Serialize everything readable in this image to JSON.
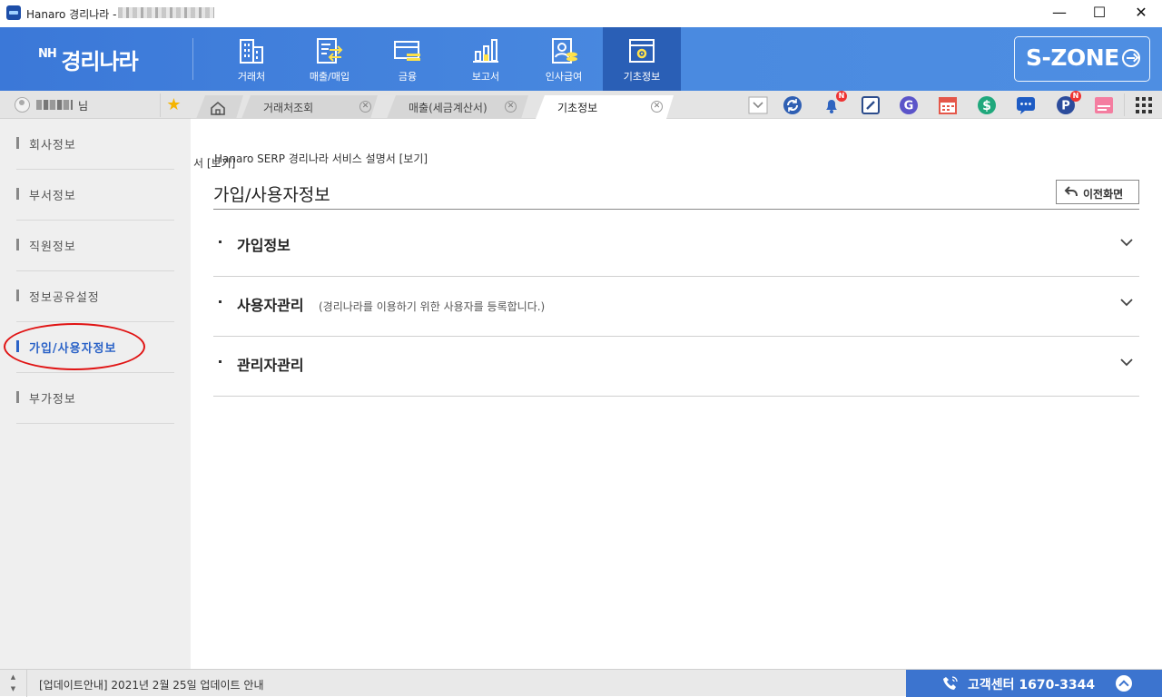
{
  "window": {
    "title": "Hanaro 경리나라 -",
    "controls": {
      "minimize": "—",
      "maximize": "☐",
      "close": "✕"
    }
  },
  "brand": {
    "prefix": "NH",
    "name": "경리나라"
  },
  "nav": {
    "items": [
      {
        "label": "거래처",
        "icon": "building-icon"
      },
      {
        "label": "매출/매입",
        "icon": "exchange-doc-icon"
      },
      {
        "label": "금융",
        "icon": "card-icon"
      },
      {
        "label": "보고서",
        "icon": "bar-chart-icon"
      },
      {
        "label": "인사급여",
        "icon": "person-coin-icon"
      },
      {
        "label": "기초정보",
        "icon": "settings-window-icon",
        "active": true
      }
    ],
    "szone": "S-ZONE"
  },
  "user": {
    "suffix": "님"
  },
  "tabs": [
    {
      "label": "거래처조회"
    },
    {
      "label": "매출(세금계산서)"
    },
    {
      "label": "기초정보",
      "active": true
    }
  ],
  "toolbar": {
    "icons": [
      "dropdown-icon",
      "sync-icon",
      "notification-bell-icon",
      "memo-edit-icon",
      "g-circle-icon",
      "calendar-icon",
      "dollar-icon",
      "chat-icon",
      "p-circle-icon",
      "memo-pink-icon",
      "apps-grid-icon"
    ],
    "badge_label": "N"
  },
  "sidebar": {
    "items": [
      {
        "label": "회사정보"
      },
      {
        "label": "부서정보"
      },
      {
        "label": "직원정보"
      },
      {
        "label": "정보공유설정"
      },
      {
        "label": "가입/사용자정보",
        "active": true
      },
      {
        "label": "부가정보"
      }
    ]
  },
  "main": {
    "manual_link": "Hanaro SERP 경리나라 서비스 설명서 [보기]",
    "manual_ghost": "서 [보기]",
    "page_title": "가입/사용자정보",
    "back_button": "이전화면",
    "sections": [
      {
        "title": "가입정보",
        "description": ""
      },
      {
        "title": "사용자관리",
        "description": "(경리나라를 이용하기 위한 사용자를 등록합니다.)"
      },
      {
        "title": "관리자관리",
        "description": ""
      }
    ]
  },
  "statusbar": {
    "notice": "[업데이트안내] 2021년 2월 25일 업데이트 안내",
    "call_center": "고객센터 1670-3344"
  },
  "colors": {
    "nav_bg": "#4a8ae0",
    "nav_active": "#2a5fb6",
    "accent_blue": "#2a62c7",
    "highlight_circle": "#e01414",
    "call_center_bg": "#3c74cf"
  }
}
